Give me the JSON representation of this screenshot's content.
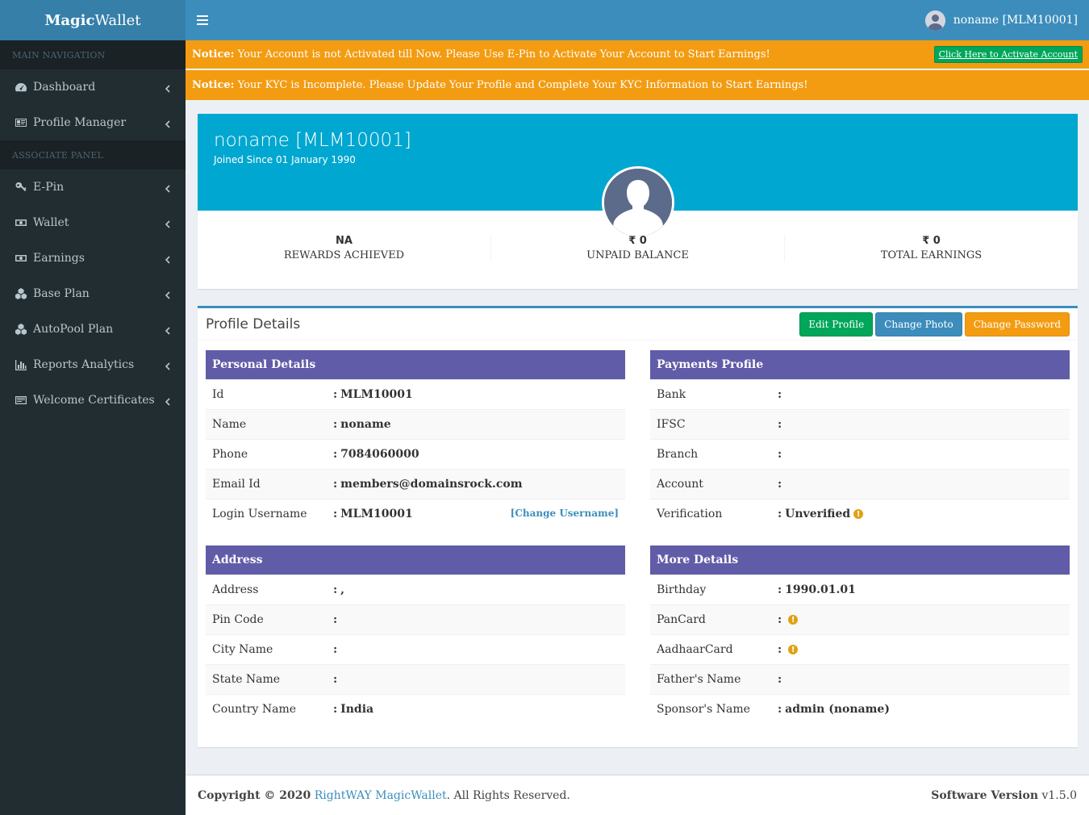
{
  "app": {
    "logo_bold": "Magic",
    "logo_rest": "Wallet"
  },
  "sidebar": {
    "header_main": "MAIN NAVIGATION",
    "header_associate": "ASSOCIATE PANEL",
    "main_items": [
      {
        "label": "Dashboard",
        "icon": "dashboard-icon"
      },
      {
        "label": "Profile Manager",
        "icon": "id-card-icon"
      }
    ],
    "associate_items": [
      {
        "label": "E-Pin",
        "icon": "key-icon"
      },
      {
        "label": "Wallet",
        "icon": "money-icon"
      },
      {
        "label": "Earnings",
        "icon": "money-icon"
      },
      {
        "label": "Base Plan",
        "icon": "cubes-icon"
      },
      {
        "label": "AutoPool Plan",
        "icon": "cubes-icon"
      },
      {
        "label": "Reports Analytics",
        "icon": "bar-chart-icon"
      },
      {
        "label": "Welcome Certificates",
        "icon": "certificate-icon"
      }
    ]
  },
  "header": {
    "user": "noname [MLM10001]"
  },
  "notices": {
    "label": "Notice:",
    "activation": "Your Account is not Activated till Now. Please Use E-Pin to Activate Your Account to Start Earnings!",
    "activation_button": "Click Here to Activate Account",
    "kyc": "Your KYC is Incomplete. Please Update Your Profile and Complete Your KYC Information to Start Earnings!"
  },
  "widget": {
    "username": "noname [MLM10001]",
    "joined": "Joined Since 01 January 1990",
    "stats": [
      {
        "value": "NA",
        "label": "REWARDS ACHIEVED"
      },
      {
        "value": "₹ 0",
        "label": "UNPAID BALANCE"
      },
      {
        "value": "₹ 0",
        "label": "TOTAL EARNINGS"
      }
    ]
  },
  "profile": {
    "title": "Profile Details",
    "buttons": {
      "edit": "Edit Profile",
      "photo": "Change Photo",
      "password": "Change Password"
    },
    "personal": {
      "title": "Personal Details",
      "change_username": "[Change Username]",
      "rows": [
        {
          "k": "Id",
          "v": "MLM10001"
        },
        {
          "k": "Name",
          "v": "noname"
        },
        {
          "k": "Phone",
          "v": "7084060000"
        },
        {
          "k": "Email Id",
          "v": "members@domainsrock.com"
        },
        {
          "k": "Login Username",
          "v": "MLM10001"
        }
      ]
    },
    "payments": {
      "title": "Payments Profile",
      "rows": [
        {
          "k": "Bank",
          "v": ""
        },
        {
          "k": "IFSC",
          "v": ""
        },
        {
          "k": "Branch",
          "v": ""
        },
        {
          "k": "Account",
          "v": ""
        },
        {
          "k": "Verification",
          "v": "Unverified"
        }
      ]
    },
    "address": {
      "title": "Address",
      "rows": [
        {
          "k": "Address",
          "v": ","
        },
        {
          "k": "Pin Code",
          "v": ""
        },
        {
          "k": "City Name",
          "v": ""
        },
        {
          "k": "State Name",
          "v": ""
        },
        {
          "k": "Country Name",
          "v": "India"
        }
      ]
    },
    "more": {
      "title": "More Details",
      "rows": [
        {
          "k": "Birthday",
          "v": "1990.01.01"
        },
        {
          "k": "PanCard",
          "v": ""
        },
        {
          "k": "AadhaarCard",
          "v": ""
        },
        {
          "k": "Father's Name",
          "v": ""
        },
        {
          "k": "Sponsor's Name",
          "v": "admin (noname)"
        }
      ]
    }
  },
  "footer": {
    "copyright": "Copyright © 2020",
    "brand": "RightWAY MagicWallet",
    "rights": ". All Rights Reserved.",
    "version_label": "Software Version",
    "version": "v1.5.0"
  },
  "colors": {
    "header": "#3c8dbc",
    "sidebar": "#222d32",
    "notice": "#f39c12",
    "widget": "#00a7d0",
    "panel_head": "#605ca8"
  }
}
